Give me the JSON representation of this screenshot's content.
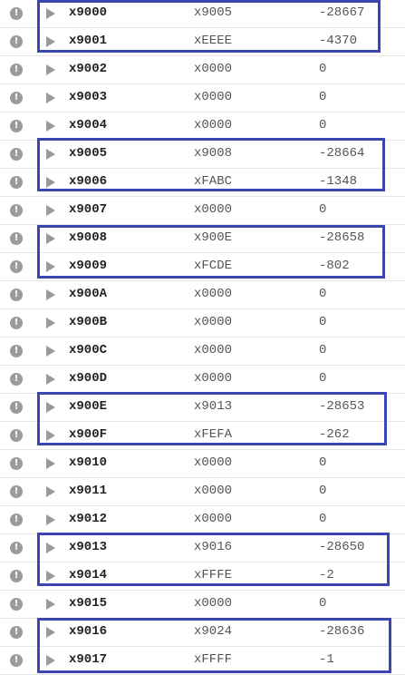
{
  "rows": [
    {
      "address": "x9000",
      "hex": "x9005",
      "value": "-28667"
    },
    {
      "address": "x9001",
      "hex": "xEEEE",
      "value": "-4370"
    },
    {
      "address": "x9002",
      "hex": "x0000",
      "value": "0"
    },
    {
      "address": "x9003",
      "hex": "x0000",
      "value": "0"
    },
    {
      "address": "x9004",
      "hex": "x0000",
      "value": "0"
    },
    {
      "address": "x9005",
      "hex": "x9008",
      "value": "-28664"
    },
    {
      "address": "x9006",
      "hex": "xFABC",
      "value": "-1348"
    },
    {
      "address": "x9007",
      "hex": "x0000",
      "value": "0"
    },
    {
      "address": "x9008",
      "hex": "x900E",
      "value": "-28658"
    },
    {
      "address": "x9009",
      "hex": "xFCDE",
      "value": "-802"
    },
    {
      "address": "x900A",
      "hex": "x0000",
      "value": "0"
    },
    {
      "address": "x900B",
      "hex": "x0000",
      "value": "0"
    },
    {
      "address": "x900C",
      "hex": "x0000",
      "value": "0"
    },
    {
      "address": "x900D",
      "hex": "x0000",
      "value": "0"
    },
    {
      "address": "x900E",
      "hex": "x9013",
      "value": "-28653"
    },
    {
      "address": "x900F",
      "hex": "xFEFA",
      "value": "-262"
    },
    {
      "address": "x9010",
      "hex": "x0000",
      "value": "0"
    },
    {
      "address": "x9011",
      "hex": "x0000",
      "value": "0"
    },
    {
      "address": "x9012",
      "hex": "x0000",
      "value": "0"
    },
    {
      "address": "x9013",
      "hex": "x9016",
      "value": "-28650"
    },
    {
      "address": "x9014",
      "hex": "xFFFE",
      "value": "-2"
    },
    {
      "address": "x9015",
      "hex": "x0000",
      "value": "0"
    },
    {
      "address": "x9016",
      "hex": "x9024",
      "value": "-28636"
    },
    {
      "address": "x9017",
      "hex": "xFFFF",
      "value": "-1"
    }
  ],
  "icons": {
    "breakpoint": "!",
    "breakpoint_icon_name": "breakpoint-icon",
    "pc_arrow_icon_name": "pc-arrow-icon"
  },
  "colors": {
    "highlight_border": "#3c45b4",
    "breakpoint_fill": "#9b9b9b",
    "arrow_fill": "#9a9a9a",
    "address_text": "#222222",
    "value_text": "#555555",
    "row_divider": "#e6e6e6"
  },
  "highlighted_rows": [
    [
      0,
      1
    ],
    [
      5,
      6
    ],
    [
      8,
      9
    ],
    [
      14,
      15
    ],
    [
      19,
      20
    ],
    [
      22,
      23
    ]
  ]
}
